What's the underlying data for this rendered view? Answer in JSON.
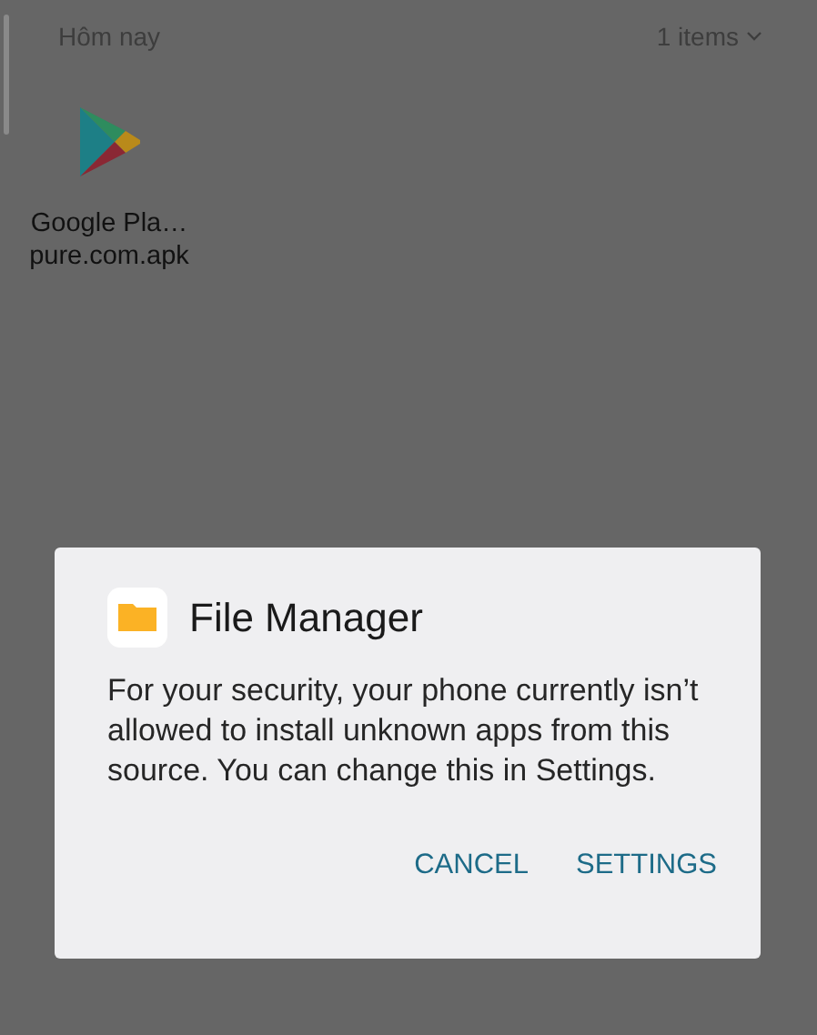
{
  "section": {
    "title": "Hôm nay",
    "count": "1 items"
  },
  "files": [
    {
      "name_line_1": "Google Pla…",
      "name_line_2": "pure.com.apk"
    }
  ],
  "dialog": {
    "title": "File Manager",
    "message": "For your security, your phone currently isn’t allowed to install unknown apps from this source. You can change this in Settings.",
    "buttons": [
      "CANCEL",
      "SETTINGS"
    ]
  }
}
